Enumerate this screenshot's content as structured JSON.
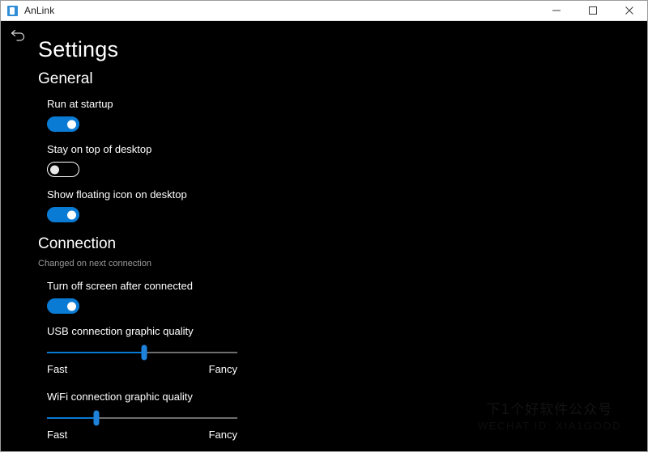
{
  "window": {
    "app_title": "AnLink",
    "app_icon": "anlink-app-icon",
    "controls": {
      "minimize": "minimize-icon",
      "maximize": "maximize-icon",
      "close": "close-icon"
    }
  },
  "page": {
    "back_icon": "back-arrow-icon",
    "title": "Settings"
  },
  "sections": {
    "general": {
      "header": "General",
      "settings": [
        {
          "label": "Run at startup",
          "state": "on"
        },
        {
          "label": "Stay on top of desktop",
          "state": "off"
        },
        {
          "label": "Show floating icon on desktop",
          "state": "on"
        }
      ]
    },
    "connection": {
      "header": "Connection",
      "note": "Changed on next connection",
      "settings": [
        {
          "label": "Turn off screen after connected",
          "state": "on"
        }
      ],
      "sliders": [
        {
          "label": "USB connection graphic quality",
          "min_label": "Fast",
          "max_label": "Fancy",
          "percent": 51
        },
        {
          "label": "WiFi connection graphic quality",
          "min_label": "Fast",
          "max_label": "Fancy",
          "percent": 26
        }
      ]
    }
  },
  "watermark": {
    "line1": "下1个好软件公众号",
    "line2": "WECHAT ID: XIA1GOOD"
  },
  "colors": {
    "accent": "#0A7BD4",
    "background": "#000000",
    "titlebar": "#FFFFFF",
    "text": "#FFFFFF",
    "muted_text": "#9A9A9A",
    "slider_rail": "#6E6E6E"
  }
}
